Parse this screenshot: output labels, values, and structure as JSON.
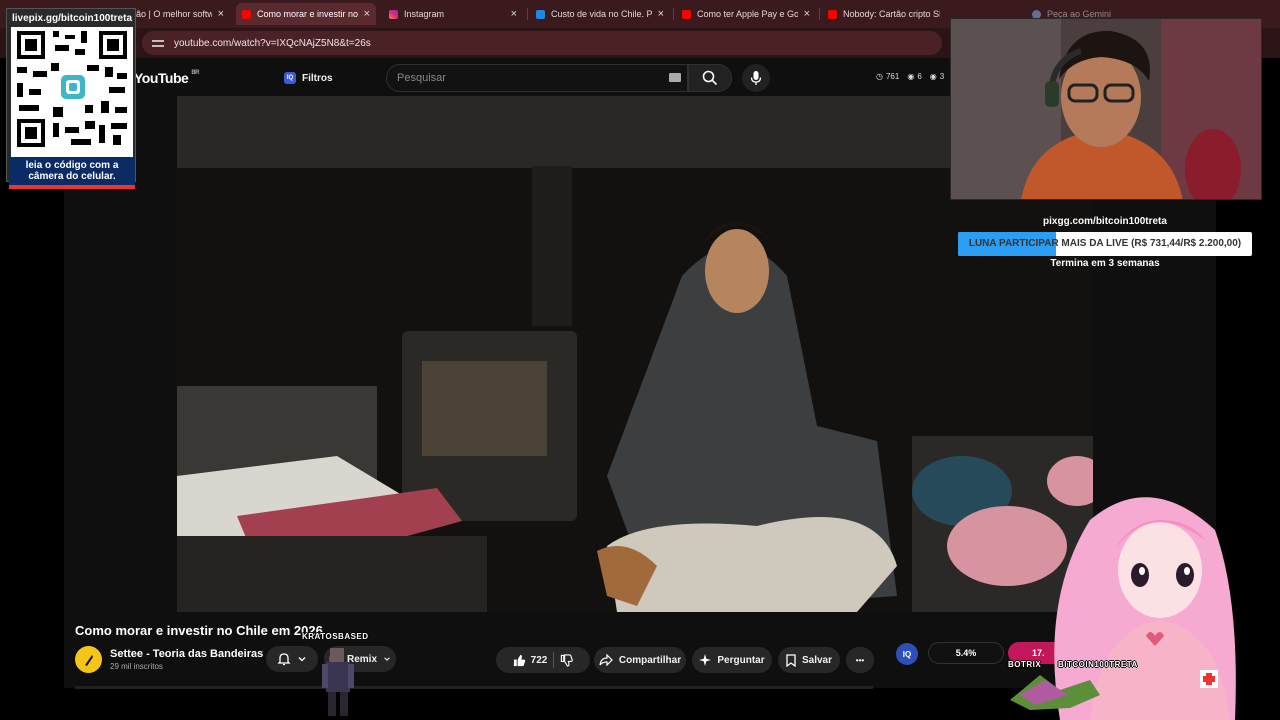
{
  "browser": {
    "tabs": [
      {
        "title": "ão | O melhor softw",
        "favicon_color": "#ff0000",
        "active": false
      },
      {
        "title": "Como morar e investir no C",
        "favicon_color": "#ff0000",
        "active": true
      },
      {
        "title": "Instagram",
        "favicon_color": "#e1306c",
        "active": false
      },
      {
        "title": "Custo de vida no Chile. Pre",
        "favicon_color": "#1e88e5",
        "active": false
      },
      {
        "title": "Como ter Apple Pay e Goo",
        "favicon_color": "#ff0000",
        "active": false
      },
      {
        "title": "Nobody: Cartão cripto SEM",
        "favicon_color": "#ff0000",
        "active": false
      },
      {
        "title": "Peça ao Gemini",
        "favicon_color": "#8ab4f8",
        "active": false
      }
    ],
    "close_glyph": "×",
    "url": "youtube.com/watch?v=IXQcNAjZ5N8&t=26s"
  },
  "youtube": {
    "logo": "YouTube",
    "region": "BR",
    "filter_label": "Filtros",
    "filter_badge": "IQ",
    "search_placeholder": "Pesquisar",
    "stats": {
      "s1": "761",
      "s2": "6",
      "s3": "3"
    },
    "video_title": "Como morar e investir no Chile em 2026",
    "channel_name": "Settee - Teoria das Bandeiras",
    "subscribers": "29 mil inscritos",
    "remix_label": "Remix",
    "likes": "722",
    "share_label": "Compartilhar",
    "ask_label": "Perguntar",
    "save_label": "Salvar",
    "more_glyph": "•••"
  },
  "overlay": {
    "qr_url": "livepix.gg/bitcoin100treta",
    "qr_caption_1": "leia o código com a",
    "qr_caption_2": "câmera do celular.",
    "goal_url": "pixgg.com/bitcoin100treta",
    "goal_text": "LUNA PARTICIPAR MAIS DA LIVE (R$ 731,44/R$ 2.200,00)",
    "goal_progress_percent": 33.2,
    "goal_end": "Termina em 3 semanas",
    "iq_badge": "IQ",
    "percent_1": "5.4%",
    "percent_2": "17.",
    "name_kratos": "KRATOSBASED",
    "name_botrix": "BOTRIX",
    "name_bitcoin": "BITCOIN100TRETA"
  },
  "colors": {
    "accent_blue": "#2b9df2",
    "youtube_bg": "#0f0f0f",
    "browser_bar": "#3a1a1d",
    "vtuber_pink": "#f6a9d1"
  }
}
